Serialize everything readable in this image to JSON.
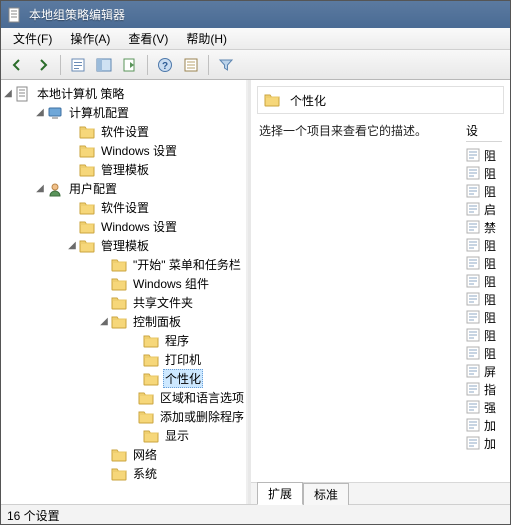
{
  "window": {
    "title": "本地组策略编辑器"
  },
  "menu": {
    "items": [
      {
        "label": "文件(F)"
      },
      {
        "label": "操作(A)"
      },
      {
        "label": "查看(V)"
      },
      {
        "label": "帮助(H)"
      }
    ]
  },
  "toolbar": {
    "icons": [
      "back-icon",
      "forward-icon",
      "sep",
      "up-icon",
      "show-hide-tree-icon",
      "export-icon",
      "sep",
      "help-icon",
      "properties-icon",
      "sep",
      "filter-icon"
    ]
  },
  "tree": {
    "root": {
      "label": "本地计算机 策略",
      "icon": "policy-root-icon",
      "expanded": true,
      "children": [
        {
          "label": "计算机配置",
          "icon": "computer-config-icon",
          "expanded": true,
          "children": [
            {
              "label": "软件设置",
              "icon": "folder-icon"
            },
            {
              "label": "Windows 设置",
              "icon": "folder-icon"
            },
            {
              "label": "管理模板",
              "icon": "folder-icon"
            }
          ]
        },
        {
          "label": "用户配置",
          "icon": "user-config-icon",
          "expanded": true,
          "children": [
            {
              "label": "软件设置",
              "icon": "folder-icon"
            },
            {
              "label": "Windows 设置",
              "icon": "folder-icon"
            },
            {
              "label": "管理模板",
              "icon": "folder-icon",
              "expanded": true,
              "children": [
                {
                  "label": "\"开始\" 菜单和任务栏",
                  "icon": "folder-icon"
                },
                {
                  "label": "Windows 组件",
                  "icon": "folder-icon"
                },
                {
                  "label": "共享文件夹",
                  "icon": "folder-icon"
                },
                {
                  "label": "控制面板",
                  "icon": "folder-icon",
                  "expanded": true,
                  "children": [
                    {
                      "label": "程序",
                      "icon": "folder-icon"
                    },
                    {
                      "label": "打印机",
                      "icon": "folder-icon"
                    },
                    {
                      "label": "个性化",
                      "icon": "folder-icon",
                      "selected": true
                    },
                    {
                      "label": "区域和语言选项",
                      "icon": "folder-icon"
                    },
                    {
                      "label": "添加或删除程序",
                      "icon": "folder-icon"
                    },
                    {
                      "label": "显示",
                      "icon": "folder-icon"
                    }
                  ]
                },
                {
                  "label": "网络",
                  "icon": "folder-icon"
                },
                {
                  "label": "系统",
                  "icon": "folder-icon"
                }
              ]
            }
          ]
        }
      ]
    }
  },
  "right": {
    "header_title": "个性化",
    "description": "选择一个项目来查看它的描述。",
    "columns": {
      "settings": "设"
    },
    "items": [
      {
        "label": "阻"
      },
      {
        "label": "阻"
      },
      {
        "label": "阻"
      },
      {
        "label": "启"
      },
      {
        "label": "禁"
      },
      {
        "label": "阻"
      },
      {
        "label": "阻"
      },
      {
        "label": "阻"
      },
      {
        "label": "阻"
      },
      {
        "label": "阻"
      },
      {
        "label": "阻"
      },
      {
        "label": "阻"
      },
      {
        "label": "屏"
      },
      {
        "label": "指"
      },
      {
        "label": "强"
      },
      {
        "label": "加"
      },
      {
        "label": "加"
      }
    ],
    "tabs": {
      "extended": "扩展",
      "standard": "标准"
    }
  },
  "status": {
    "text": "16 个设置"
  }
}
